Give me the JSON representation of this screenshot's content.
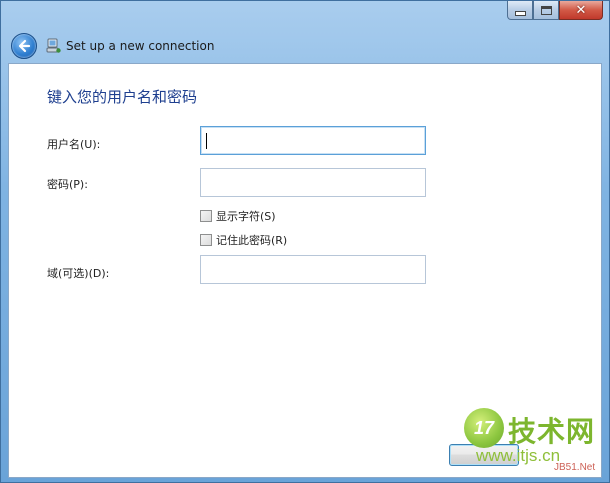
{
  "window": {
    "title": "Set up a new connection"
  },
  "icons": {
    "back": "back-arrow-icon",
    "wizard": "network-wizard-icon",
    "minimize": "minimize-icon",
    "maximize": "maximize-icon",
    "close": "close-icon"
  },
  "caption_buttons": {
    "close_glyph": "✕"
  },
  "form": {
    "heading": "键入您的用户名和密码",
    "username_label": "用户名(U):",
    "username_value": "",
    "password_label": "密码(P):",
    "password_value": "",
    "show_chars_label": "显示字符(S)",
    "show_chars_checked": false,
    "remember_label": "记住此密码(R)",
    "remember_checked": false,
    "domain_label": "域(可选)(D):",
    "domain_value": ""
  },
  "footer": {
    "next_label": ""
  },
  "watermark": {
    "circle_text": "17",
    "brand": "技术网",
    "url": "www.itjs.cn",
    "small": "JB51.Net"
  },
  "colors": {
    "heading": "#1e3f8f",
    "frame": "#7fb3e2",
    "close_button": "#c0392b"
  }
}
